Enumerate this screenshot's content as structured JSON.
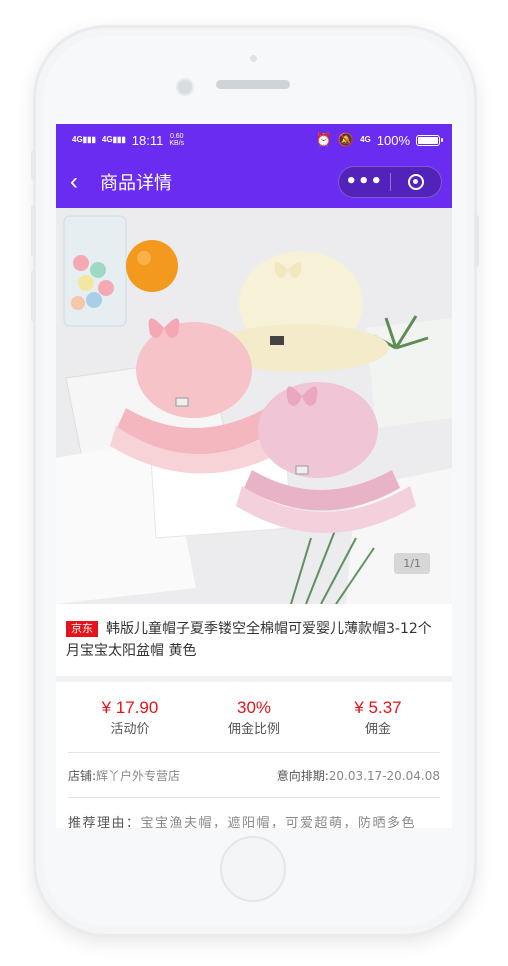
{
  "statusbar": {
    "signal1": "4G",
    "signal2": "4G",
    "time": "18:11",
    "speed_value": "0.60",
    "speed_unit": "KB/s",
    "network_right": "4G",
    "battery": "100%",
    "battery_level": 1.0
  },
  "navbar": {
    "title": "商品详情"
  },
  "image": {
    "pager": "1/1"
  },
  "product": {
    "badge": "京东",
    "title": "韩版儿童帽子夏季镂空全棉帽可爱婴儿薄款帽3-12个月宝宝太阳盆帽 黄色"
  },
  "metrics": [
    {
      "value": "¥ 17.90",
      "label": "活动价"
    },
    {
      "value": "30%",
      "label": "佣金比例"
    },
    {
      "value": "¥ 5.37",
      "label": "佣金"
    }
  ],
  "shop": {
    "label": "店铺:",
    "name": "辉丫户外专营店",
    "schedule_label": "意向排期:",
    "schedule": "20.03.17-20.04.08"
  },
  "reason": {
    "label": "推荐理由：",
    "text": "宝宝渔夫帽，遮阳帽，可爱超萌，防晒多色"
  },
  "colors": {
    "brand": "#6a2cf0",
    "price": "#e4151a"
  }
}
